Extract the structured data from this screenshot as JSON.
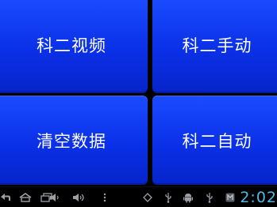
{
  "tiles": [
    {
      "label": "科二视频"
    },
    {
      "label": "科二手动"
    },
    {
      "label": "清空数据"
    },
    {
      "label": "科二自动"
    }
  ],
  "navbar": {
    "icons": [
      "back-icon",
      "home-icon",
      "recent-apps-icon",
      "volume-down-icon",
      "volume-up-icon",
      "menu-icon"
    ],
    "status_icons": [
      "screen-rotation-icon",
      "usb-icon",
      "android-debug-icon",
      "usb-icon",
      "notification-app-icon"
    ],
    "clock": "2:02"
  },
  "colors": {
    "tile_blue": "#0a30e8",
    "clock_blue": "#52b8e8",
    "background": "#000000"
  }
}
